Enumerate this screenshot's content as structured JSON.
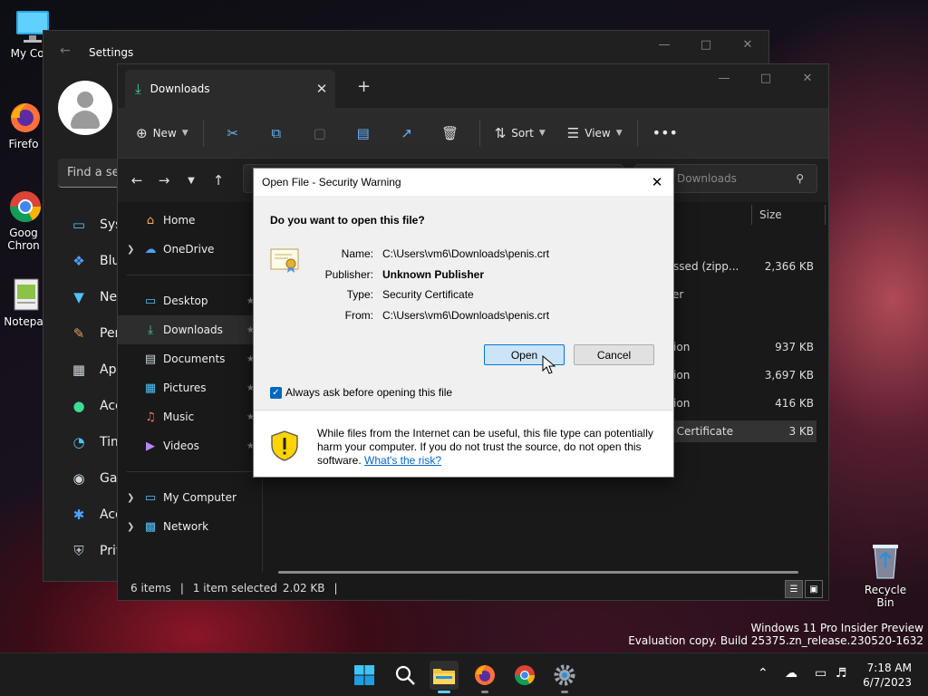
{
  "desktop": {
    "icons": [
      {
        "label": "My Com",
        "icon": "computer-icon"
      },
      {
        "label": "Firefo",
        "icon": "firefox-icon"
      },
      {
        "label": "Goog\nChron",
        "icon": "chrome-icon"
      },
      {
        "label": "Notepa",
        "icon": "notepad-icon"
      }
    ],
    "recycle_bin": "Recycle Bin",
    "watermark_line1": "Windows 11 Pro Insider Preview",
    "watermark_line2": "Evaluation copy. Build 25375.zn_release.230520-1632"
  },
  "settings": {
    "title": "Settings",
    "find_placeholder": "Find a se",
    "nav": [
      {
        "label": "Syst",
        "icon": "system-icon",
        "color": "#4fc3f7"
      },
      {
        "label": "Blue",
        "icon": "bluetooth-icon",
        "color": "#4aa3ff"
      },
      {
        "label": "Net",
        "icon": "wifi-icon",
        "color": "#4fc3f7"
      },
      {
        "label": "Pers",
        "icon": "brush-icon",
        "color": "#e0a060"
      },
      {
        "label": "App",
        "icon": "apps-icon",
        "color": "#cfd8dc"
      },
      {
        "label": "Acc",
        "icon": "account-icon",
        "color": "#3ddc97"
      },
      {
        "label": "Tim",
        "icon": "time-icon",
        "color": "#4fc3f7"
      },
      {
        "label": "Gan",
        "icon": "gaming-icon",
        "color": "#cfd8dc"
      },
      {
        "label": "Acc",
        "icon": "accessibility-icon",
        "color": "#4aa3ff"
      },
      {
        "label": "Priv",
        "icon": "shield-icon",
        "color": "#b0bec5"
      }
    ]
  },
  "explorer": {
    "tab_label": "Downloads",
    "toolbar": {
      "new_label": "New",
      "sort_label": "Sort",
      "view_label": "View"
    },
    "search_placeholder": "Downloads",
    "sidebar": [
      {
        "label": "Home",
        "icon": "home-icon",
        "chevron": false,
        "pinned": false,
        "selected": false
      },
      {
        "label": "OneDrive",
        "icon": "cloud-icon",
        "chevron": true,
        "pinned": false,
        "selected": false
      },
      {
        "label": "Desktop",
        "icon": "desktop-folder-icon",
        "chevron": false,
        "pinned": true,
        "selected": false
      },
      {
        "label": "Downloads",
        "icon": "download-icon",
        "chevron": false,
        "pinned": true,
        "selected": true
      },
      {
        "label": "Documents",
        "icon": "document-icon",
        "chevron": false,
        "pinned": true,
        "selected": false
      },
      {
        "label": "Pictures",
        "icon": "pictures-icon",
        "chevron": false,
        "pinned": true,
        "selected": false
      },
      {
        "label": "Music",
        "icon": "music-icon",
        "chevron": false,
        "pinned": true,
        "selected": false
      },
      {
        "label": "Videos",
        "icon": "videos-icon",
        "chevron": false,
        "pinned": true,
        "selected": false
      },
      {
        "label": "My Computer",
        "icon": "computer-icon",
        "chevron": true,
        "pinned": false,
        "selected": false
      },
      {
        "label": "Network",
        "icon": "network-icon",
        "chevron": true,
        "pinned": false,
        "selected": false
      }
    ],
    "size_header": "Size",
    "rows": [
      {
        "type": "ressed (zipp...",
        "size": "2,366 KB",
        "selected": false
      },
      {
        "type": "lder",
        "size": "",
        "selected": false
      },
      {
        "type": "ation",
        "size": "937 KB",
        "selected": false
      },
      {
        "type": "ation",
        "size": "3,697 KB",
        "selected": false
      },
      {
        "type": "ation",
        "size": "416 KB",
        "selected": false
      },
      {
        "type": "ty Certificate",
        "size": "3 KB",
        "selected": true
      }
    ],
    "status": {
      "items": "6 items",
      "selected": "1 item selected",
      "size": "2.02 KB"
    }
  },
  "dialog": {
    "title": "Open File - Security Warning",
    "question": "Do you want to open this file?",
    "name_label": "Name:",
    "name_value": "C:\\Users\\vm6\\Downloads\\penis.crt",
    "publisher_label": "Publisher:",
    "publisher_value": "Unknown Publisher",
    "type_label": "Type:",
    "type_value": "Security Certificate",
    "from_label": "From:",
    "from_value": "C:\\Users\\vm6\\Downloads\\penis.crt",
    "open_label": "Open",
    "cancel_label": "Cancel",
    "checkbox_label": "Always ask before opening this file",
    "checkbox_checked": true,
    "warning_text": "While files from the Internet can be useful, this file type can potentially harm your computer. If you do not trust the source, do not open this software.",
    "risk_link": "What's the risk?"
  },
  "taskbar": {
    "apps": [
      "start-icon",
      "search-icon",
      "file-explorer-icon",
      "firefox-icon",
      "chrome-icon",
      "settings-icon"
    ],
    "time": "7:18 AM",
    "date": "6/7/2023"
  }
}
